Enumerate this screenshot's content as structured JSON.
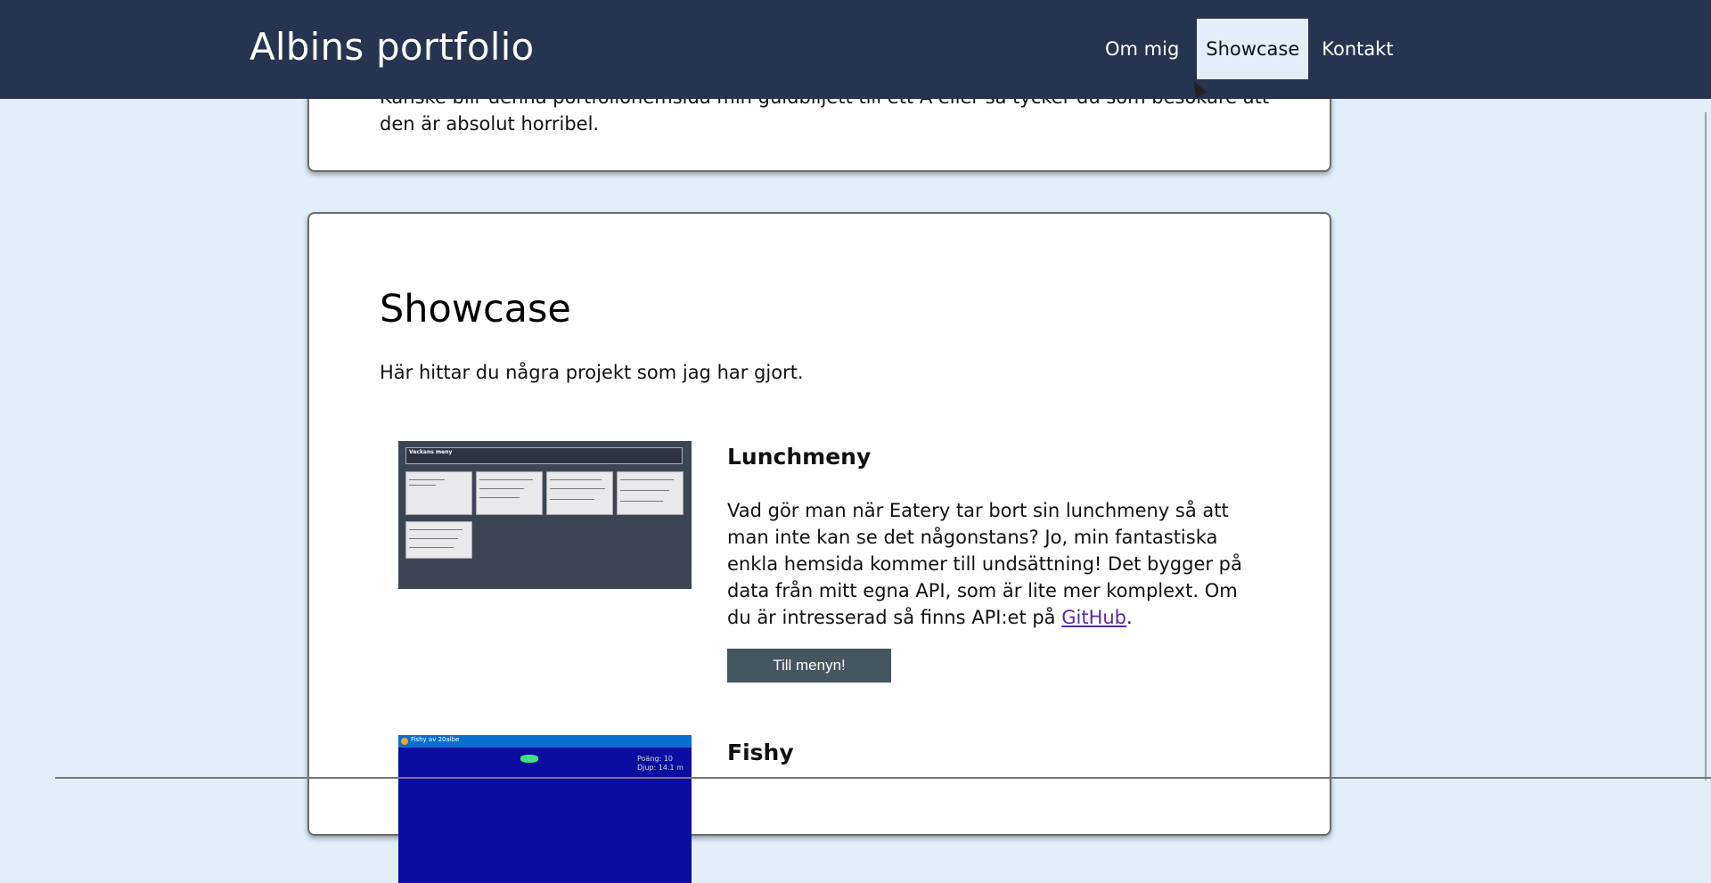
{
  "header": {
    "brand": "Albins portfolio",
    "nav": [
      {
        "label": "Om mig",
        "active": false
      },
      {
        "label": "Showcase",
        "active": true
      },
      {
        "label": "Kontakt",
        "active": false
      }
    ]
  },
  "about": {
    "text_clipped": "Kanske blir denna portfoliohemsida min guldbiljett till ett A eller så tycker du som besökare att den är absolut horribel."
  },
  "showcase": {
    "title": "Showcase",
    "intro": "Här hittar du några projekt som jag har gjort.",
    "projects": [
      {
        "title": "Lunchmeny",
        "desc_before_link": "Vad gör man när Eatery tar bort sin lunchmeny så att man inte kan se det någonstans? Jo, min fantastiska enkla hemsida kommer till undsättning! Det bygger på data från mitt egna API, som är lite mer komplext. Om du är intresserad så finns API:et på ",
        "link_label": "GitHub",
        "desc_after_link": ".",
        "button_label": "Till menyn!",
        "screenshot": {
          "heading": "Veckans meny"
        }
      },
      {
        "title": "Fishy",
        "screenshot": {
          "window_title": "Fishy av 20albe",
          "score_line1": "Poäng: 10",
          "score_line2": "Djup: 14.1 m"
        }
      }
    ]
  },
  "colors": {
    "header_bg": "#263450",
    "page_bg": "#e1effb",
    "button_bg": "#45565e",
    "link": "#5a2aa0"
  }
}
